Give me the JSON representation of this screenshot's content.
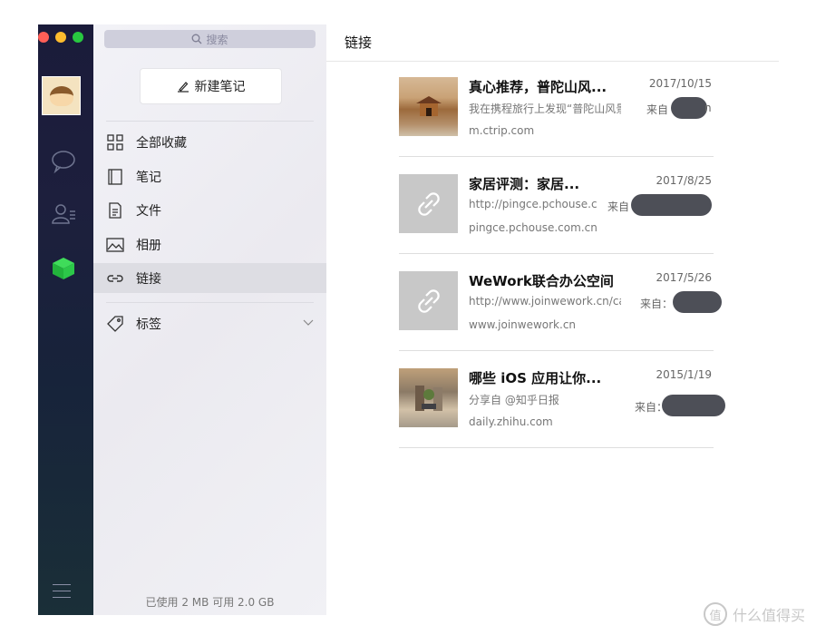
{
  "sidebar": {
    "search_placeholder": "搜索",
    "new_note_label": "新建笔记",
    "items": [
      {
        "label": "全部收藏",
        "icon": "grid-icon"
      },
      {
        "label": "笔记",
        "icon": "notebook-icon"
      },
      {
        "label": "文件",
        "icon": "file-icon"
      },
      {
        "label": "相册",
        "icon": "image-icon"
      },
      {
        "label": "链接",
        "icon": "link-icon",
        "active": true
      }
    ],
    "tags_label": "标签",
    "storage_text": "已使用 2 MB 可用 2.0 GB"
  },
  "main": {
    "title": "链接",
    "links": [
      {
        "title": "真心推荐，普陀山风...",
        "date": "2017/10/15",
        "description": "我在携程旅行上发现“普陀山风景",
        "from_label": "来自",
        "from_suffix": "n",
        "domain": "m.ctrip.com",
        "thumb": "temple-photo"
      },
      {
        "title": "家居评测：家居...",
        "date": "2017/8/25",
        "description": "http://pingce.pchouse.c",
        "from_label": "来自",
        "from_suffix": "",
        "domain": "pingce.pchouse.com.cn",
        "thumb": "link-placeholder"
      },
      {
        "title": "WeWork联合办公空间",
        "date": "2017/5/26",
        "description": "http://www.joinwework.cn/car",
        "from_label": "来自：",
        "from_suffix": "",
        "domain": "www.joinwework.cn",
        "thumb": "link-placeholder"
      },
      {
        "title": "哪些 iOS 应用让你...",
        "date": "2015/1/19",
        "description": "分享自 @知乎日报",
        "from_label": "来自：",
        "from_suffix": "",
        "domain": "daily.zhihu.com",
        "thumb": "street-photo"
      }
    ]
  },
  "watermark": {
    "badge": "值",
    "text": "什么值得买"
  },
  "colors": {
    "rail": "#1b1d3b",
    "sidebar_bg": "#efeff3",
    "active_row": "#dddde3",
    "redaction": "#4d4f57"
  }
}
